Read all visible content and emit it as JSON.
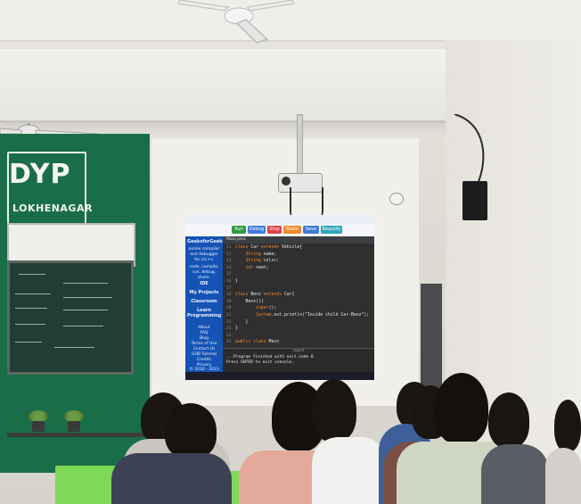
{
  "scene": {
    "logo": {
      "main": "DYP",
      "sub": "LOKHENAGAR"
    },
    "colors": {
      "wall_green": "#1a6e47",
      "sidebar_blue": "#1553b5"
    }
  },
  "screen": {
    "sidebar": [
      "GeeksforGeeks",
      "online compiler and debugger for c/c++",
      "code, compile, run, debug, share.",
      "IDE",
      "My Projects",
      "Classroom",
      "Learn Programming",
      "About",
      "FAQ",
      "Blog",
      "Terms of Use",
      "Contact Us",
      "GDB Tutorial",
      "Credits",
      "Privacy",
      "© 2016 - 2023 GDB Online"
    ],
    "toolbar": [
      "Run",
      "Debug",
      "Stop",
      "Share",
      "Save",
      "Beautify"
    ],
    "tab": "Main.java",
    "code_lines": [
      {
        "n": "11",
        "text": "class Car extends Vehicle{"
      },
      {
        "n": "12",
        "text": "    String name;"
      },
      {
        "n": "13",
        "text": "    String color;"
      },
      {
        "n": "14",
        "text": "    int seat;"
      },
      {
        "n": "15",
        "text": ""
      },
      {
        "n": "16",
        "text": "}"
      },
      {
        "n": "17",
        "text": ""
      },
      {
        "n": "18",
        "text": "class Benz extends Car{"
      },
      {
        "n": "19",
        "text": "    Benz(){"
      },
      {
        "n": "20",
        "text": "        super();"
      },
      {
        "n": "21",
        "text": "        System.out.println(\"Inside child Car-Benz\");"
      },
      {
        "n": "22",
        "text": "    }"
      },
      {
        "n": "23",
        "text": "}"
      },
      {
        "n": "24",
        "text": ""
      },
      {
        "n": "25",
        "text": "public class Main"
      }
    ],
    "console_label": "input",
    "console_lines": [
      "...Program finished with exit code 0",
      "Press ENTER to exit console."
    ]
  }
}
